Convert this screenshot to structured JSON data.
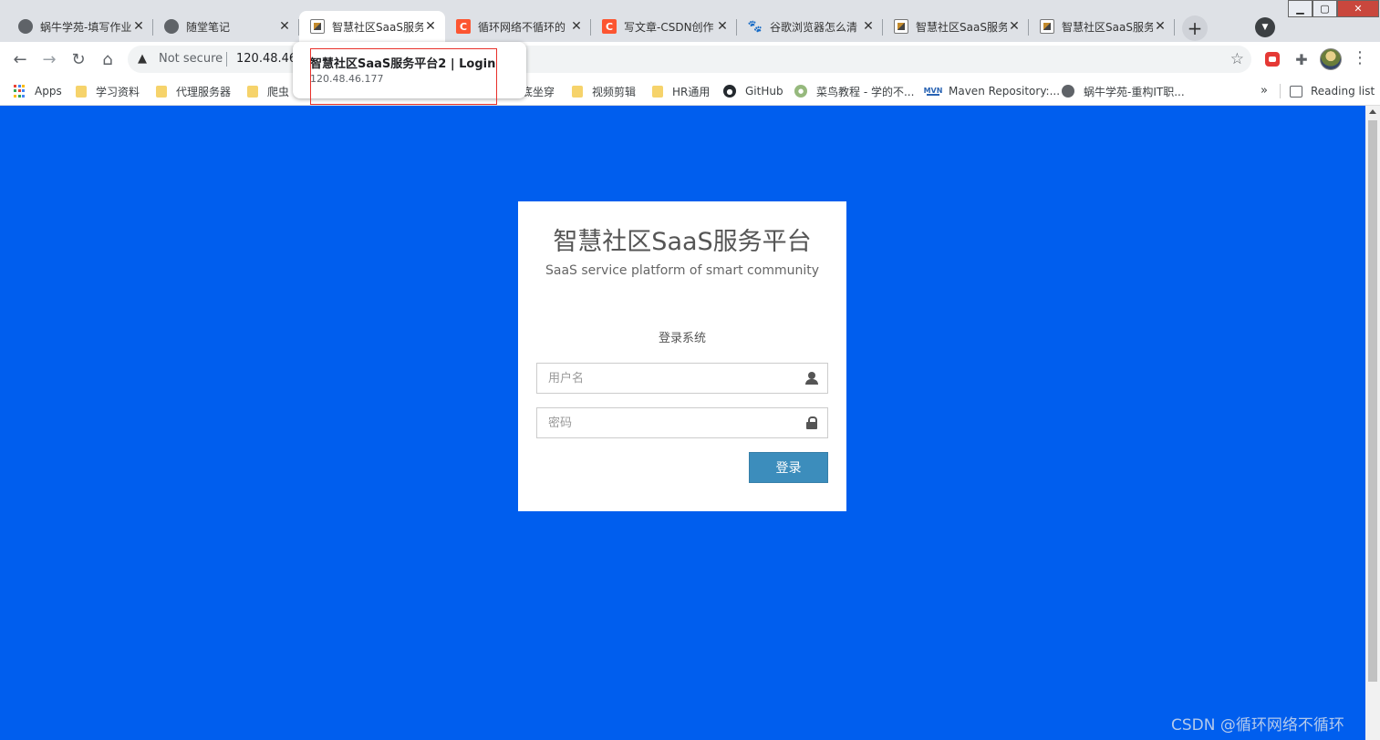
{
  "browser": {
    "tabs": [
      {
        "title": "蜗牛学苑-填写作业",
        "icon": "globe-icon"
      },
      {
        "title": "随堂笔记",
        "icon": "globe-icon"
      },
      {
        "title": "智慧社区SaaS服务",
        "icon": "saas-favicon",
        "active": true
      },
      {
        "title": "循环网络不循环的",
        "icon": "csdn-icon"
      },
      {
        "title": "写文章-CSDN创作",
        "icon": "csdn-icon"
      },
      {
        "title": "谷歌浏览器怎么清",
        "icon": "baidu-paw-icon"
      },
      {
        "title": "智慧社区SaaS服务",
        "icon": "saas-favicon"
      },
      {
        "title": "智慧社区SaaS服务",
        "icon": "saas-favicon"
      }
    ],
    "omnibox": {
      "security_text": "Not secure",
      "url": "120.48.46."
    },
    "hover_card": {
      "title": "智慧社区SaaS服务平台2 | Login",
      "url": "120.48.46.177"
    },
    "bookmarks": [
      {
        "label": "Apps",
        "icon": "apps-grid-icon"
      },
      {
        "label": "学习资料",
        "icon": "folder-icon"
      },
      {
        "label": "代理服务器",
        "icon": "folder-icon"
      },
      {
        "label": "爬虫",
        "icon": "folder-icon"
      },
      {
        "label": "底坐穿",
        "icon": "folder-icon"
      },
      {
        "label": "视频剪辑",
        "icon": "folder-icon"
      },
      {
        "label": "HR通用",
        "icon": "folder-icon"
      },
      {
        "label": "GitHub",
        "icon": "github-icon"
      },
      {
        "label": "菜鸟教程 - 学的不...",
        "icon": "runoob-icon"
      },
      {
        "label": "Maven Repository:...",
        "icon": "maven-icon"
      },
      {
        "label": "蜗牛学苑-重构IT职...",
        "icon": "globe-icon"
      }
    ],
    "reading_list_label": "Reading list",
    "more_bookmarks": "»"
  },
  "page": {
    "title": "智慧社区SaaS服务平台",
    "subtitle": "SaaS service platform of smart community",
    "heading": "登录系统",
    "username_placeholder": "用户名",
    "password_placeholder": "密码",
    "login_button": "登录",
    "background_color": "#005eee",
    "button_color": "#3c8dbc"
  },
  "watermark": "CSDN @循环网络不循环"
}
